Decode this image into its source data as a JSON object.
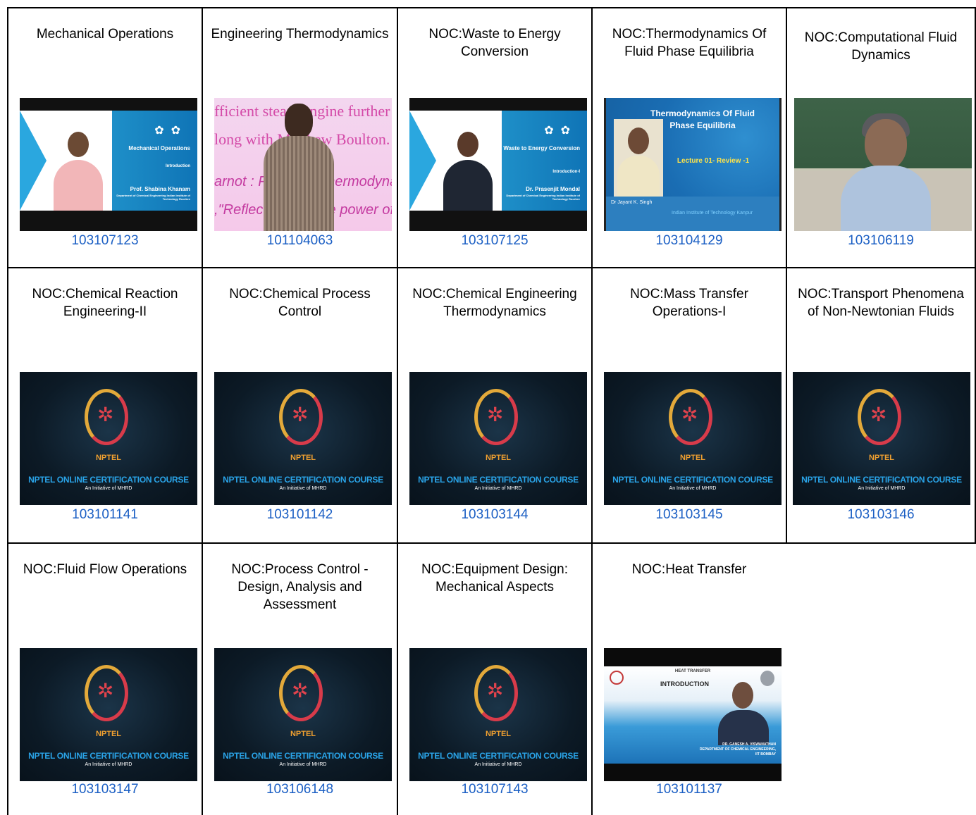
{
  "courses": [
    {
      "title": "Mechanical Operations",
      "code": "103107123"
    },
    {
      "title": "Engineering Thermodynamics",
      "code": "101104063"
    },
    {
      "title": "NOC:Waste to Energy Conversion",
      "code": "103107125"
    },
    {
      "title": "NOC:Thermodynamics Of Fluid Phase Equilibria",
      "code": "103104129"
    },
    {
      "title": "NOC:Computational Fluid Dynamics",
      "code": "103106119"
    },
    {
      "title": "NOC:Chemical Reaction Engineering-II",
      "code": "103101141"
    },
    {
      "title": "NOC:Chemical Process Control",
      "code": "103101142"
    },
    {
      "title": "NOC:Chemical Engineering Thermodynamics",
      "code": "103103144"
    },
    {
      "title": "NOC:Mass Transfer Operations-I",
      "code": "103103145"
    },
    {
      "title": "NOC:Transport Phenomena of Non-Newtonian Fluids",
      "code": "103103146"
    },
    {
      "title": "NOC:Fluid Flow Operations",
      "code": "103103147"
    },
    {
      "title": "NOC:Process Control - Design, Analysis and Assessment",
      "code": "103106148"
    },
    {
      "title": "NOC:Equipment Design: Mechanical Aspects",
      "code": "103107143"
    },
    {
      "title": "NOC:Heat Transfer",
      "code": "103101137"
    }
  ],
  "thumbs": {
    "mech_ops": {
      "title": "Mechanical Operations",
      "sub": "Introduction",
      "name": "Prof. Shabina Khanam",
      "dept": "Department of Chemical Engineering Indian Institute of Technology Roorkee"
    },
    "eng_thermo": {
      "l1": "fficient steam engine further and",
      "l2": "long with Matthew Boulton.",
      "l3": "arnot : Father of Thermodynamic",
      "l4": ",\"Reflections on the power of fire"
    },
    "waste": {
      "title": "Waste to Energy Conversion",
      "sub": "Introduction-I",
      "name": "Dr. Prasenjit Mondal",
      "dept": "Department of Chemical Engineering Indian Institute of Technology Roorkee"
    },
    "fluid_phase": {
      "title": "Thermodynamics Of Fluid Phase Equilibria",
      "lecture": "Lecture 01- Review -1",
      "name": "Dr Jayant K. Singh",
      "inst": "Indian Institute of Technology Kanpur"
    },
    "nptel": {
      "logo": "NPTEL",
      "course": "NPTEL ONLINE CERTIFICATION COURSE",
      "initiative": "An Initiative of MHRD"
    },
    "heat": {
      "header": "HEAT TRANSFER",
      "intro": "INTRODUCTION",
      "caption": "DR. GANESH A. VISWANATHAN DEPARTMENT OF CHEMICAL ENGINEERING, IIT BOMBAY"
    }
  },
  "colors": {
    "link": "#1b5fc4",
    "border": "#000000"
  }
}
